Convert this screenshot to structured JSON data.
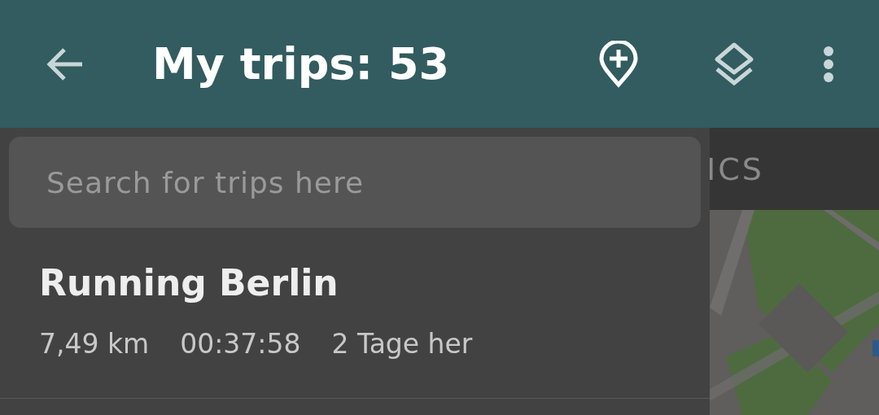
{
  "app_bar": {
    "title": "My trips: 53"
  },
  "search": {
    "placeholder": "Search for trips here"
  },
  "trips": [
    {
      "name": "Running Berlin",
      "distance": "7,49 km",
      "duration": "00:37:58",
      "age": "2 Tage her"
    }
  ],
  "background": {
    "tab_label": "ICS"
  }
}
